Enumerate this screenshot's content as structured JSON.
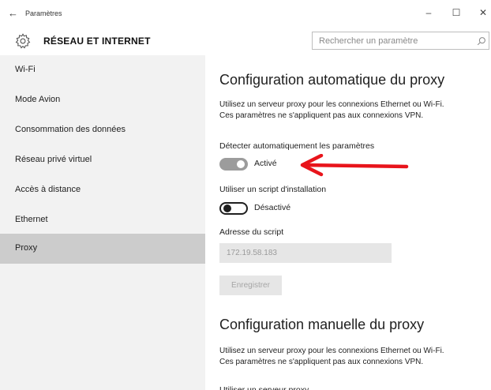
{
  "window": {
    "title": "Paramètres",
    "back_glyph": "←",
    "minimize_glyph": "–",
    "maximize_glyph": "☐",
    "close_glyph": "✕"
  },
  "header": {
    "section_title": "RÉSEAU ET INTERNET",
    "icon": "gear-icon",
    "search_placeholder": "Rechercher un paramètre"
  },
  "sidebar": {
    "items": [
      {
        "label": "Wi-Fi"
      },
      {
        "label": "Mode Avion"
      },
      {
        "label": "Consommation des données"
      },
      {
        "label": "Réseau privé virtuel"
      },
      {
        "label": "Accès à distance"
      },
      {
        "label": "Ethernet"
      },
      {
        "label": "Proxy",
        "selected": true
      }
    ]
  },
  "auto": {
    "heading": "Configuration automatique du proxy",
    "desc_line1": "Utilisez un serveur proxy pour les connexions Ethernet ou Wi-Fi.",
    "desc_line2": "Ces paramètres ne s'appliquent pas aux connexions VPN.",
    "detect_label": "Détecter automatiquement les paramètres",
    "detect_state": "Activé",
    "script_label": "Utiliser un script d'installation",
    "script_state": "Désactivé",
    "address_label": "Adresse du script",
    "address_value": "172.19.58.183",
    "save_label": "Enregistrer"
  },
  "manual": {
    "heading": "Configuration manuelle du proxy",
    "desc_line1": "Utilisez un serveur proxy pour les connexions Ethernet ou Wi-Fi.",
    "desc_line2": "Ces paramètres ne s'appliquent pas aux connexions VPN.",
    "use_proxy_label": "Utiliser un serveur proxy"
  },
  "colors": {
    "accent_arrow": "#e8141b",
    "sidebar_bg": "#f2f2f2",
    "selected_bg": "#cccccc"
  }
}
